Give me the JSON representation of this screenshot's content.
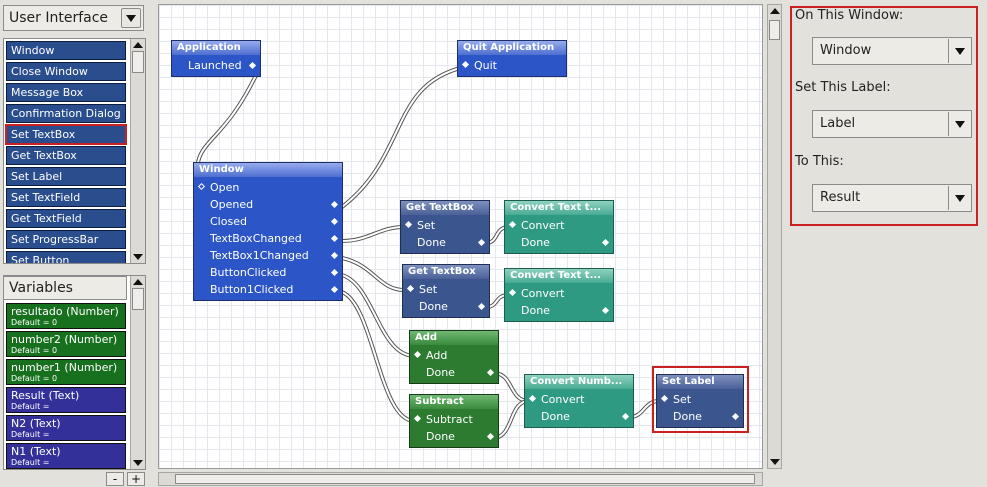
{
  "left_panel": {
    "category": "User Interface",
    "actions": [
      "Window",
      "Close Window",
      "Message Box",
      "Confirmation Dialog",
      "Set TextBox",
      "Get TextBox",
      "Set Label",
      "Set TextField",
      "Get TextField",
      "Set ProgressBar",
      "Set Button"
    ],
    "selected_action": "Set TextBox",
    "variables_header": "Variables",
    "variables": [
      {
        "name": "resultado (Number)",
        "default": "Default = 0",
        "kind": "number"
      },
      {
        "name": "number2 (Number)",
        "default": "Default = 0",
        "kind": "number"
      },
      {
        "name": "number1 (Number)",
        "default": "Default = 0",
        "kind": "number"
      },
      {
        "name": "Result (Text)",
        "default": "Default =",
        "kind": "text"
      },
      {
        "name": "N2 (Text)",
        "default": "Default =",
        "kind": "text"
      },
      {
        "name": "N1 (Text)",
        "default": "Default =",
        "kind": "text"
      }
    ],
    "remove_label": "-",
    "add_label": "+"
  },
  "canvas": {
    "nodes": {
      "application": {
        "title": "Application",
        "ports": [
          "Launched"
        ]
      },
      "quit": {
        "title": "Quit Application",
        "ports": [
          "Quit"
        ]
      },
      "window": {
        "title": "Window",
        "ports": [
          "Open",
          "Opened",
          "Closed",
          "TextBoxChanged",
          "TextBox1Changed",
          "ButtonClicked",
          "Button1Clicked"
        ]
      },
      "get_textbox_1": {
        "title": "Get TextBox",
        "ports": [
          "Set",
          "Done"
        ]
      },
      "get_textbox_2": {
        "title": "Get TextBox",
        "ports": [
          "Set",
          "Done"
        ]
      },
      "convert_text_1": {
        "title": "Convert Text t...",
        "ports": [
          "Convert",
          "Done"
        ]
      },
      "convert_text_2": {
        "title": "Convert Text t...",
        "ports": [
          "Convert",
          "Done"
        ]
      },
      "add": {
        "title": "Add",
        "ports": [
          "Add",
          "Done"
        ]
      },
      "subtract": {
        "title": "Subtract",
        "ports": [
          "Subtract",
          "Done"
        ]
      },
      "convert_number": {
        "title": "Convert Numb...",
        "ports": [
          "Convert",
          "Done"
        ]
      },
      "set_label": {
        "title": "Set Label",
        "ports": [
          "Set",
          "Done"
        ]
      }
    }
  },
  "properties": {
    "window_label": "On This Window:",
    "window_value": "Window",
    "label_label": "Set This Label:",
    "label_value": "Label",
    "to_label": "To This:",
    "to_value": "Result"
  },
  "colors": {
    "action_item": "#2a4d8d",
    "number_var": "#17701d",
    "text_var": "#33309a",
    "highlight": "#cc1f1f"
  }
}
